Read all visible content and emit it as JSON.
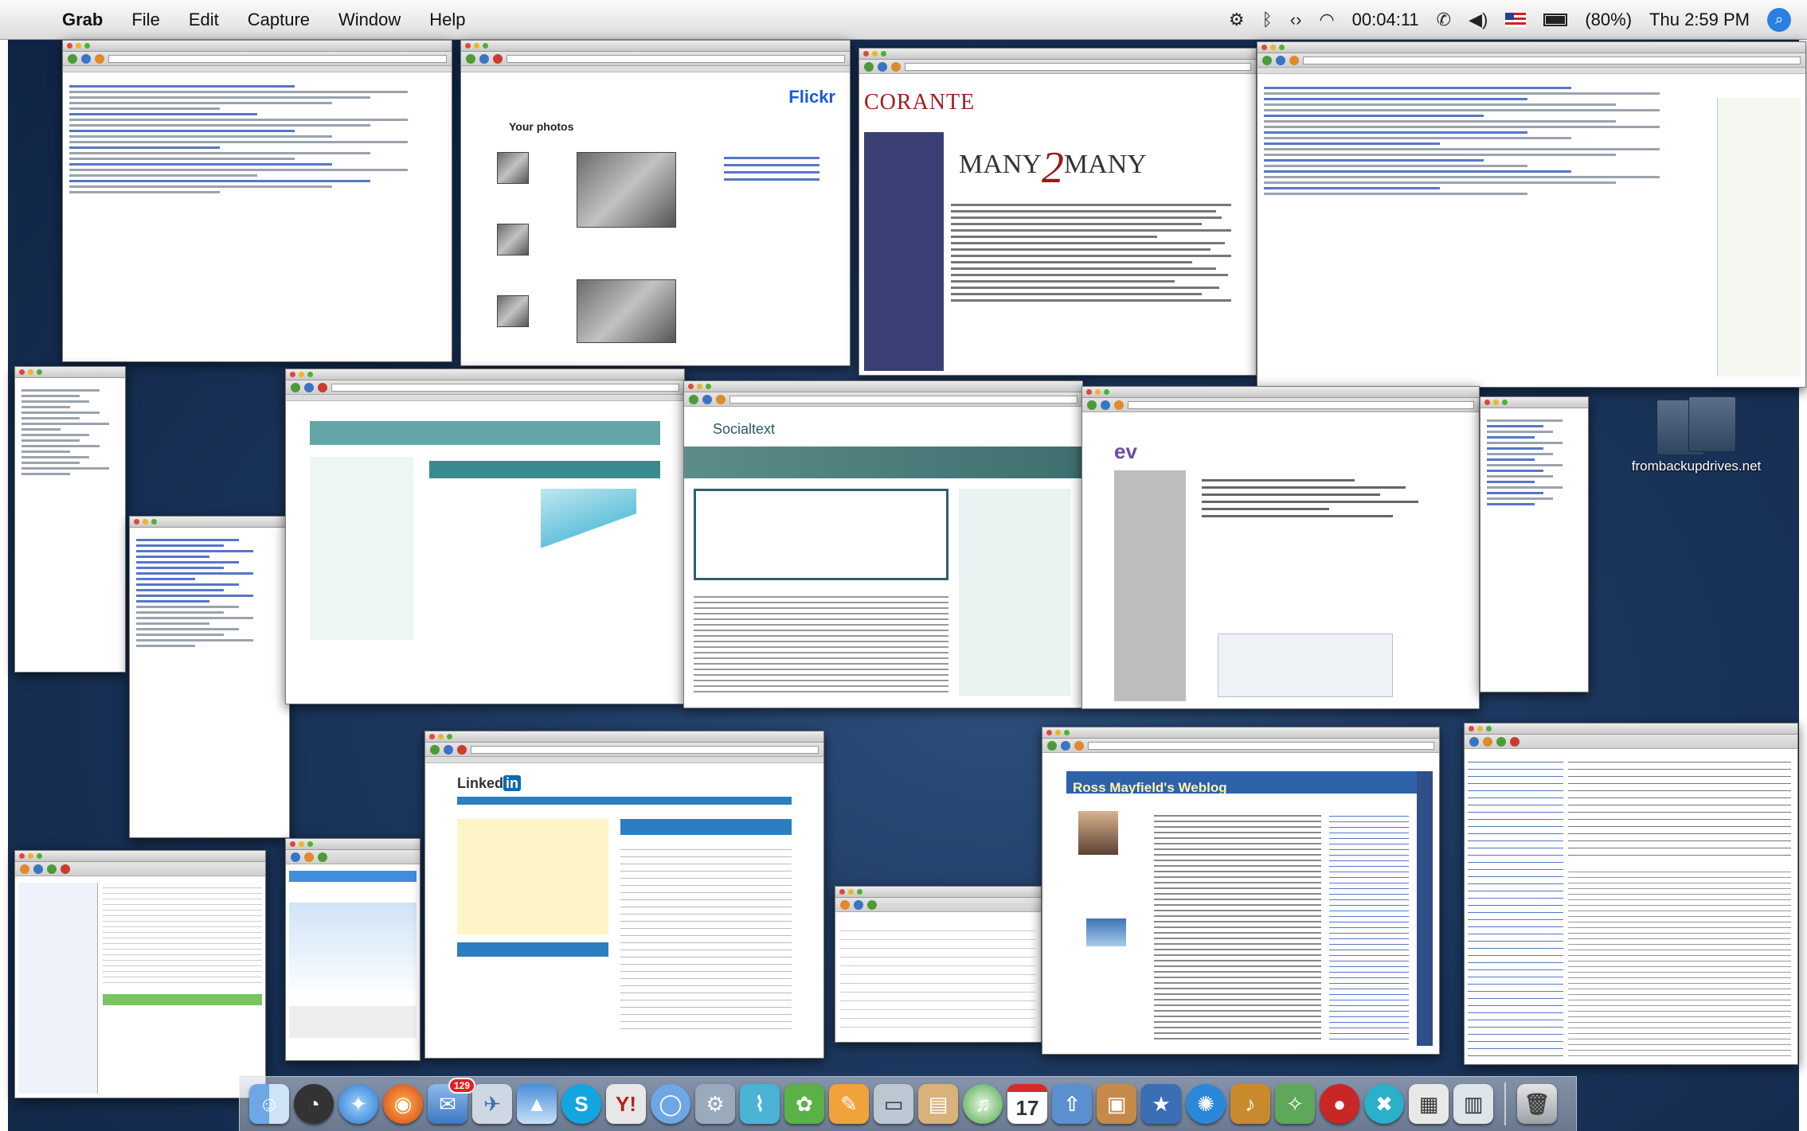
{
  "menubar": {
    "apple_glyph": "",
    "app_name": "Grab",
    "menus": [
      "File",
      "Edit",
      "Capture",
      "Window",
      "Help"
    ],
    "timer": "00:04:11",
    "battery": "(80%)",
    "clock": "Thu 2:59 PM"
  },
  "windows": {
    "flickr_logo": "Flickr",
    "flickr_heading": "Your photos",
    "corante_logo": "CORANTE",
    "m2m_left": "MANY",
    "m2m_two": "2",
    "m2m_right": "MANY",
    "socialtext_logo": "Socialtext",
    "linkedin_logo": "Linked",
    "linkedin_in": "in",
    "ev_logo": "ev",
    "blog_title": "Ross Mayfield's Weblog"
  },
  "desktop_icon": {
    "label": "frombackupdrives.net"
  },
  "dock": {
    "mail_badge": "129",
    "calendar_day": "17"
  },
  "colors": {
    "desktop": "#1b355c",
    "menubar": "#e6e6e6",
    "accent": "#2b7fe0"
  }
}
